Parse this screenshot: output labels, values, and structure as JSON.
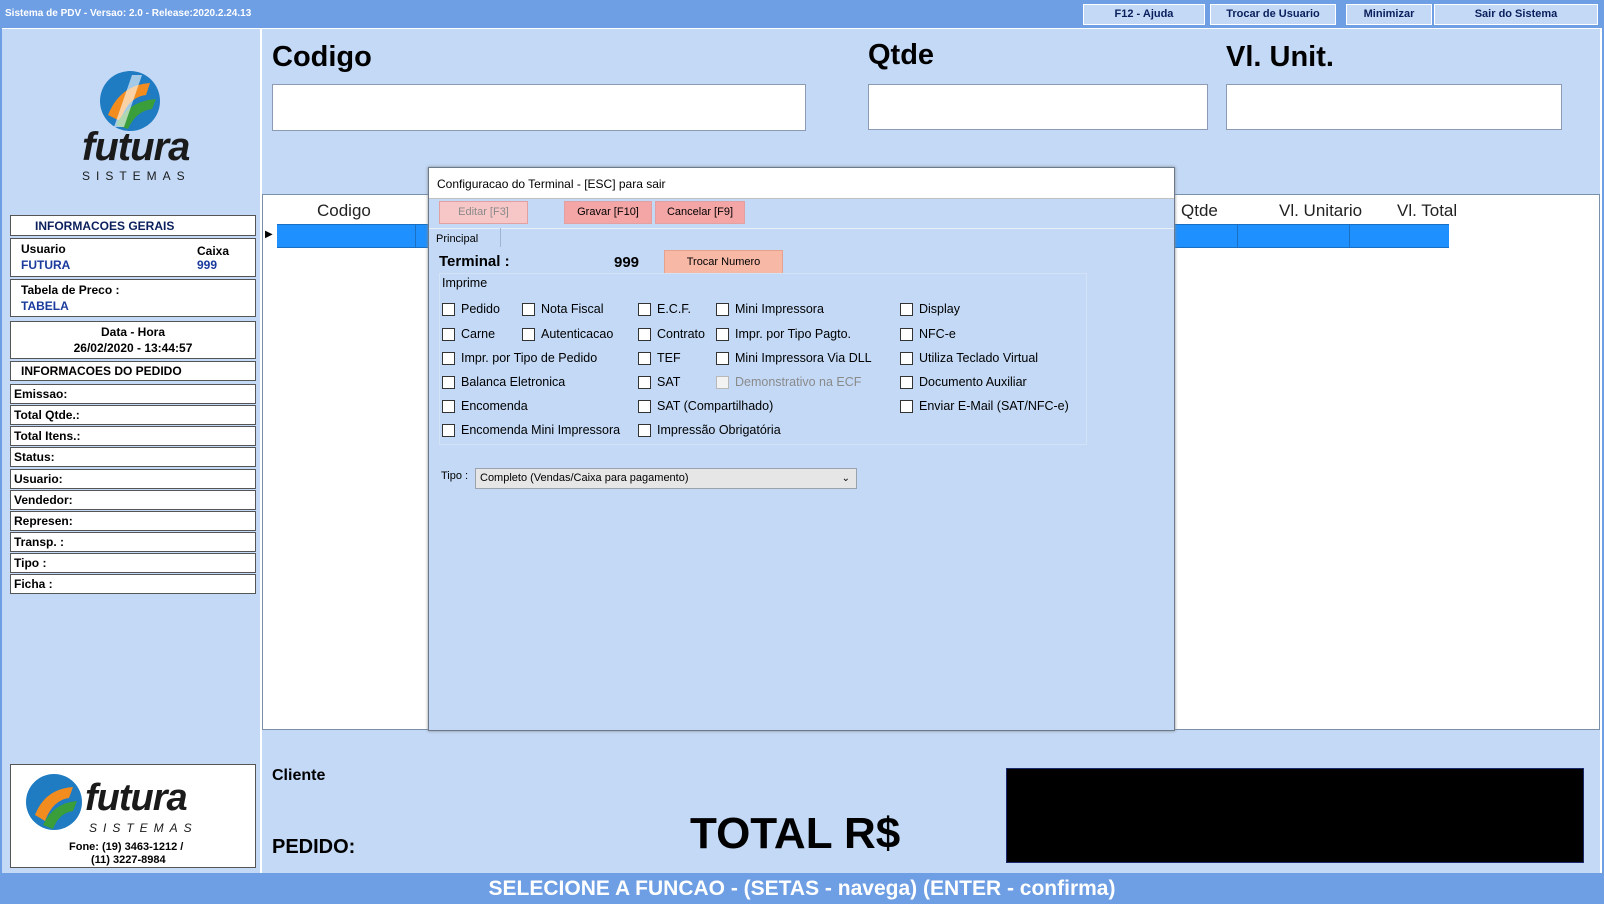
{
  "window": {
    "title": "Sistema de PDV - Versao: 2.0 - Release:2020.2.24.13",
    "buttons": [
      "F12 - Ajuda",
      "Trocar de Usuario",
      "Minimizar",
      "Sair do Sistema"
    ]
  },
  "logo": {
    "brand": "futura",
    "sub": "SISTEMAS"
  },
  "sidebar": {
    "info_title": "INFORMACOES GERAIS",
    "usuario_label": "Usuario",
    "usuario_value": "FUTURA",
    "caixa_label": "Caixa",
    "caixa_value": "999",
    "tabela_label": "Tabela de Preco :",
    "tabela_value": "TABELA",
    "datahora_label": "Data - Hora",
    "datahora_value": "26/02/2020 - 13:44:57",
    "pedido_title": "INFORMACOES DO PEDIDO",
    "fields": [
      "Emissao:",
      "Total Qtde.:",
      "Total Itens.:",
      "Status:",
      "Usuario:",
      "Vendedor:",
      "Represen:",
      "Transp. :",
      "Tipo :",
      "Ficha :"
    ],
    "footer_phone_1": "Fone: (19) 3463-1212 /",
    "footer_phone_2": "(11) 3227-8984"
  },
  "header": {
    "codigo_label": "Codigo",
    "qtde_label": "Qtde",
    "vlunit_label": "Vl. Unit.",
    "codigo_value": "",
    "qtde_value": "",
    "vlunit_value": ""
  },
  "grid": {
    "columns": [
      "Codigo",
      "Qtde",
      "Vl. Unitario",
      "Vl. Total"
    ]
  },
  "bottom": {
    "cliente_label": "Cliente",
    "pedido_label": "PEDIDO:",
    "total_label": "TOTAL R$",
    "total_value": ""
  },
  "status": "SELECIONE A FUNCAO - (SETAS - navega) (ENTER - confirma)",
  "dialog": {
    "title": "Configuracao do Terminal - [ESC] para sair",
    "buttons": {
      "editar": "Editar [F3]",
      "gravar": "Gravar [F10]",
      "cancelar": "Cancelar [F9]"
    },
    "tab": "Principal",
    "terminal_label": "Terminal :",
    "terminal_value": "999",
    "trocar_label": "Trocar Numero",
    "imprime_label": "Imprime",
    "checkboxes": {
      "col1": [
        "Pedido",
        "Carne",
        "Impr. por Tipo de Pedido",
        "Balanca Eletronica",
        "Encomenda",
        "Encomenda Mini Impressora"
      ],
      "col2": [
        "Nota Fiscal",
        "Autenticacao"
      ],
      "col3": [
        "E.C.F.",
        "Contrato",
        "TEF",
        "SAT",
        "SAT (Compartilhado)",
        "Impressão Obrigatória"
      ],
      "col4": [
        "Mini Impressora",
        "Impr. por Tipo Pagto.",
        "Mini Impressora Via DLL",
        "Demonstrativo na ECF"
      ],
      "col5": [
        "Display",
        "NFC-e",
        "Utiliza Teclado Virtual",
        "Documento Auxiliar",
        "Enviar E-Mail (SAT/NFC-e)"
      ]
    },
    "tipo_label": "Tipo :",
    "tipo_value": "Completo (Vendas/Caixa para pagamento)"
  },
  "colors": {
    "accent": "#6e9ee3",
    "panel": "#c3d9f6",
    "selected_row": "#1e90ff",
    "dark_panel": "#000000"
  }
}
